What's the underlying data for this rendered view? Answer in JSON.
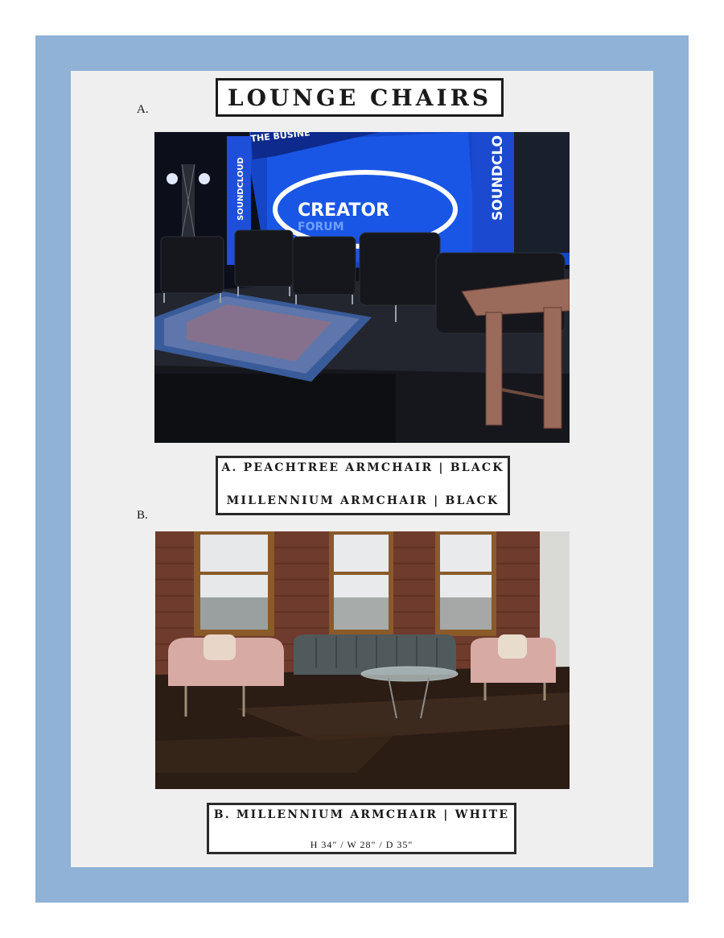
{
  "page": {
    "title": "LOUNGE CHAIRS",
    "sections": [
      {
        "letter": "A.",
        "photo_caption_lines": [
          "A. PEACHTREE ARMCHAIR | BLACK",
          "MILLENNIUM ARMCHAIR | BLACK"
        ],
        "screen_text": {
          "top": "THE BUSINE",
          "logo_main": "CREATOR",
          "logo_sub": "FORUM",
          "side": "SOUNDCLOUD",
          "side_right": "SOUNDCLO"
        }
      },
      {
        "letter": "B.",
        "photo_caption_lines": [
          "B. MILLENNIUM ARMCHAIR | WHITE"
        ],
        "dimensions": "H 34\" /   W 28\" / D 35\""
      }
    ]
  },
  "colors": {
    "frame": "#8fb2d6",
    "sheet": "#efefef",
    "border": "#1a1a1a"
  }
}
